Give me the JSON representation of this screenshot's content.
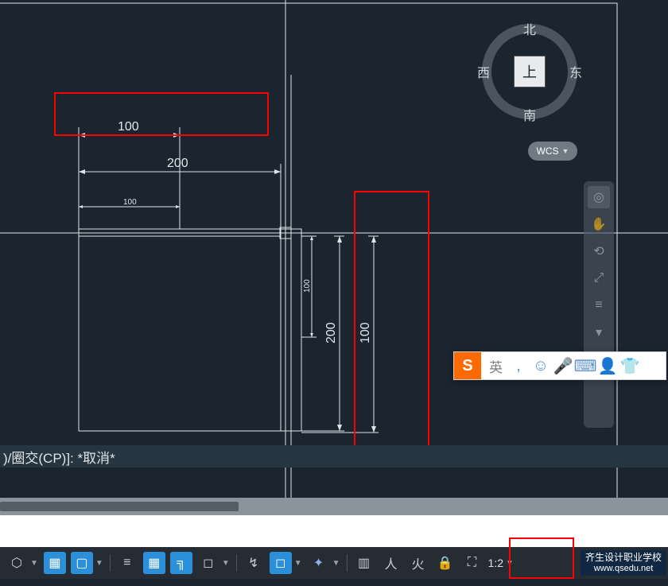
{
  "viewcube": {
    "north": "北",
    "south": "南",
    "west": "西",
    "east": "东",
    "top": "上"
  },
  "wcs_label": "WCS",
  "dimensions": {
    "h100_top": "100",
    "h200": "200",
    "h100_small": "100",
    "v200": "200",
    "v100_inner": "100",
    "v100_outer": "100"
  },
  "command_line": ")/圈交(CP)]:  *取消*",
  "ime": {
    "lang": "英",
    "comma": ", ",
    "emoji": "☺",
    "mic": "🎤",
    "kbd": "⌨",
    "user": "👤",
    "shirt": "👕"
  },
  "navbar": {
    "steering": "◎",
    "pan": "✋",
    "orbit": "⟲",
    "zoom": "⤢",
    "more": "≡",
    "expand": "▾"
  },
  "statusbar": {
    "model": "⬡",
    "grid": "▦",
    "snap": "▢",
    "infer": "≡",
    "dyn": "▦",
    "ortho": "╗",
    "polar": "◻",
    "iso": "↯",
    "osnap": "◻",
    "3dosnap": "✦",
    "lwt": "▥",
    "transp": "人",
    "qp": "火",
    "sc": "🔒",
    "ui": "⛶",
    "scale_label": "1:2"
  },
  "watermark": {
    "line1": "齐生设计职业学校",
    "line2": "www.qsedu.net"
  }
}
